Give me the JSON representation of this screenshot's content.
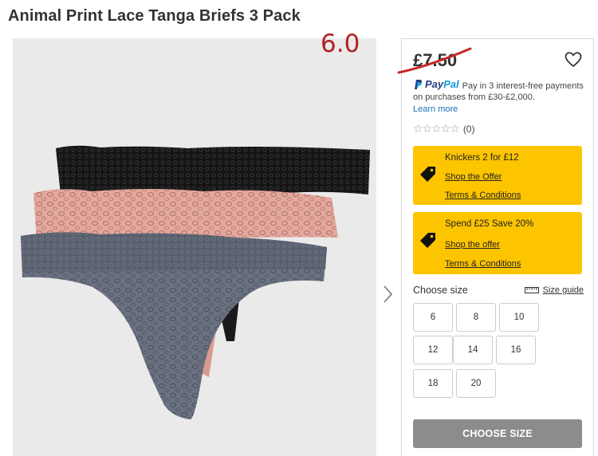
{
  "product": {
    "title": "Animal Print Lace Tanga Briefs 3 Pack",
    "price": "£7.50",
    "annotation": "6.0"
  },
  "paypal": {
    "brand_pay": "Pay",
    "brand_pal": "Pal",
    "message": "Pay in 3 interest-free payments on purchases from £30-£2,000.",
    "learn_more": "Learn more"
  },
  "rating": {
    "stars": 0,
    "max_stars": 5,
    "count": "(0)"
  },
  "offers": [
    {
      "title": "Knickers 2 for £12",
      "link": "Shop the Offer",
      "terms": "Terms & Conditions"
    },
    {
      "title": "Spend £25 Save 20%",
      "link": "Shop the offer",
      "terms": "Terms & Conditions"
    }
  ],
  "sizes": {
    "label": "Choose size",
    "guide": "Size guide",
    "options": [
      "6",
      "8",
      "10",
      "12",
      "14",
      "16",
      "18",
      "20"
    ]
  },
  "cta": {
    "label": "CHOOSE SIZE"
  },
  "icons": {
    "wishlist": "heart-icon",
    "offer": "price-tag-icon",
    "size_guide": "ruler-icon",
    "next": "chevron-right-icon"
  },
  "colors": {
    "offer_bg": "#fdc400",
    "cta_bg": "#8c8c8c",
    "strike": "#c62828",
    "link": "#1a6fb8"
  }
}
